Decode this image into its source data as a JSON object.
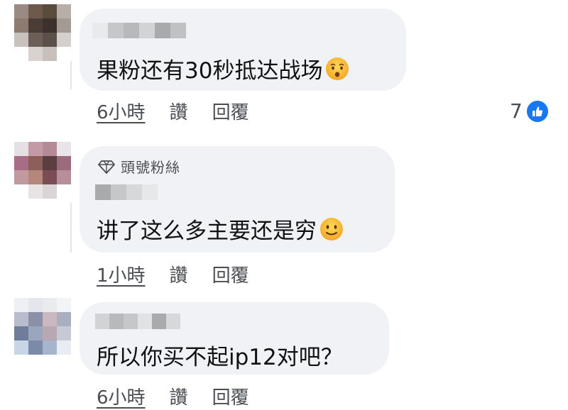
{
  "comments": [
    {
      "badge": "",
      "text": "果粉还有30秒抵达战场",
      "emoji": "hushed-face",
      "time": "6小時",
      "like_action": "讚",
      "reply_action": "回覆",
      "reactions": "7"
    },
    {
      "badge": "頭號粉絲",
      "text": "讲了这么多主要还是穷",
      "emoji": "slightly-smiling-face",
      "time": "1小時",
      "like_action": "讚",
      "reply_action": "回覆"
    },
    {
      "badge": "",
      "text": "所以你买不起ip12对吧？",
      "time": "6小時",
      "like_action": "讚",
      "reply_action": "回覆"
    }
  ],
  "colors": {
    "bubble": "#f0f2f5",
    "like_blue": "#1877f2",
    "meta": "#4a4d52"
  }
}
